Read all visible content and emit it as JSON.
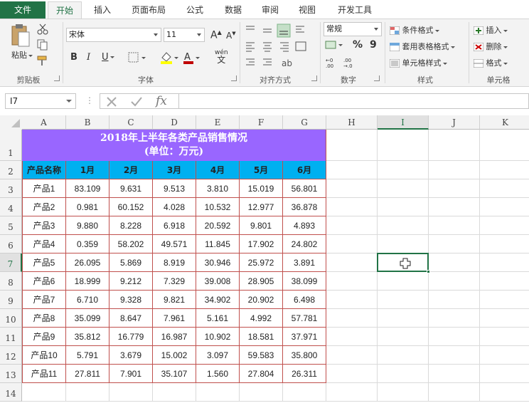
{
  "ribbon_tabs": [
    "文件",
    "开始",
    "插入",
    "页面布局",
    "公式",
    "数据",
    "审阅",
    "视图",
    "开发工具"
  ],
  "ribbon": {
    "clipboard": {
      "paste": "粘贴",
      "label": "剪贴板"
    },
    "font": {
      "name": "宋体",
      "size": "11",
      "bold": "B",
      "italic": "I",
      "underline": "U",
      "wen": "wén",
      "wen_char": "文",
      "label": "字体"
    },
    "align": {
      "label": "对齐方式"
    },
    "number": {
      "format": "常规",
      "percent": "%",
      "comma": "9",
      "label": "数字"
    },
    "styles": {
      "cond": "条件格式",
      "table": "套用表格格式",
      "cell": "单元格样式",
      "label": "样式"
    },
    "cells": {
      "insert": "插入",
      "delete": "删除",
      "format": "格式",
      "label": "单元格"
    }
  },
  "formula_bar": {
    "name_box": "I7",
    "fx": "fx",
    "value": ""
  },
  "columns": [
    "A",
    "B",
    "C",
    "D",
    "E",
    "F",
    "G",
    "H",
    "I",
    "J",
    "K"
  ],
  "rows": [
    "1",
    "2",
    "3",
    "4",
    "5",
    "6",
    "7",
    "8",
    "9",
    "10",
    "11",
    "12",
    "13",
    "14"
  ],
  "selected": {
    "col": "I",
    "row": "7"
  },
  "sheet": {
    "title_line1": "2018年上半年各类产品销售情况",
    "title_line2": "(单位：万元)",
    "headers": [
      "产品名称",
      "1月",
      "2月",
      "3月",
      "4月",
      "5月",
      "6月"
    ],
    "data": [
      [
        "产品1",
        "83.109",
        "9.631",
        "9.513",
        "3.810",
        "15.019",
        "56.801"
      ],
      [
        "产品2",
        "0.981",
        "60.152",
        "4.028",
        "10.532",
        "12.977",
        "36.878"
      ],
      [
        "产品3",
        "9.880",
        "8.228",
        "6.918",
        "20.592",
        "9.801",
        "4.893"
      ],
      [
        "产品4",
        "0.359",
        "58.202",
        "49.571",
        "11.845",
        "17.902",
        "24.802"
      ],
      [
        "产品5",
        "26.095",
        "5.869",
        "8.919",
        "30.946",
        "25.972",
        "3.891"
      ],
      [
        "产品6",
        "18.999",
        "9.212",
        "7.329",
        "39.008",
        "28.905",
        "38.099"
      ],
      [
        "产品7",
        "6.710",
        "9.328",
        "9.821",
        "34.902",
        "20.902",
        "6.498"
      ],
      [
        "产品8",
        "35.099",
        "8.647",
        "7.961",
        "5.161",
        "4.992",
        "57.781"
      ],
      [
        "产品9",
        "35.812",
        "16.779",
        "16.987",
        "10.902",
        "18.581",
        "37.971"
      ],
      [
        "产品10",
        "5.791",
        "3.679",
        "15.002",
        "3.097",
        "59.583",
        "35.800"
      ],
      [
        "产品11",
        "27.811",
        "7.901",
        "35.107",
        "1.560",
        "27.804",
        "26.311"
      ]
    ]
  },
  "colors": {
    "accent": "#217346",
    "title_bg": "#9966ff",
    "header_bg": "#00b0f0",
    "border": "#c0504d"
  }
}
